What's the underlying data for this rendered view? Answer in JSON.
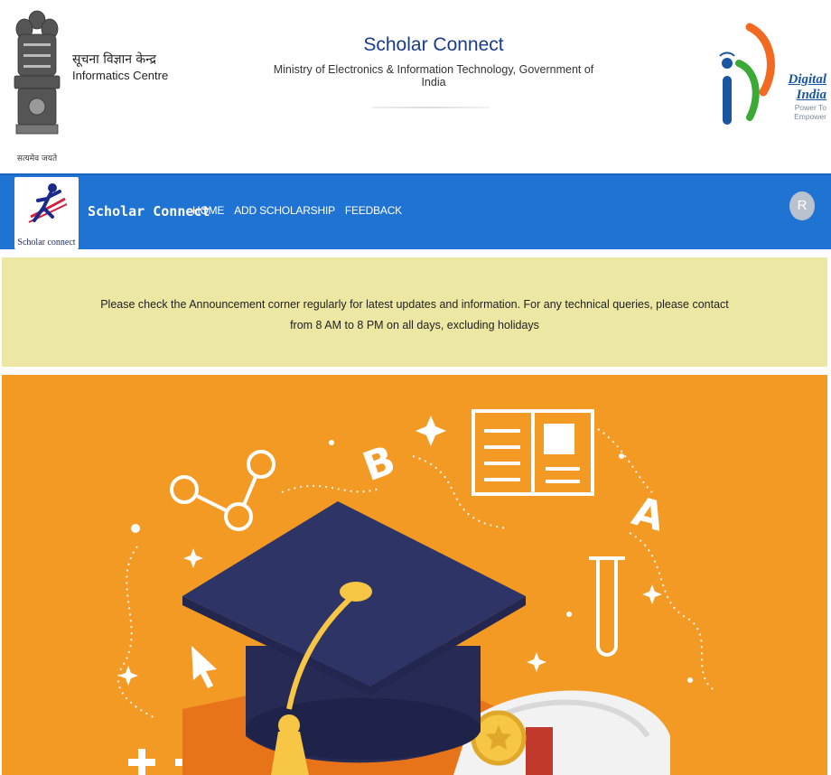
{
  "header": {
    "emblem_motto": "सत्यमेव जयते",
    "org_hindi": "सूचना विज्ञान केन्द्र",
    "org_english": "Informatics Centre",
    "site_title": "Scholar Connect",
    "ministry": "Ministry of Electronics & Information Technology, Government of India",
    "digital_india": {
      "title": "Digital India",
      "tagline": "Power To Empower"
    }
  },
  "navbar": {
    "logo_caption": "Scholar connect",
    "brand": "Scholar Connect",
    "links": [
      "HOME",
      "ADD SCHOLARSHIP",
      "FEEDBACK"
    ],
    "avatar_initial": "R"
  },
  "announcement": {
    "line1": "Please check the Announcement corner regularly for latest updates and information. For any technical queries, please contact",
    "line2": "from 8 AM to 8 PM on all days, excluding holidays"
  },
  "hero": {
    "letters": [
      "B",
      "A"
    ],
    "symbols": [
      "+",
      "−"
    ]
  },
  "colors": {
    "navbar": "#1f74d3",
    "announcement_bg": "#ece7a3",
    "hero_bg": "#f39a25",
    "cap": "#2f3466"
  }
}
